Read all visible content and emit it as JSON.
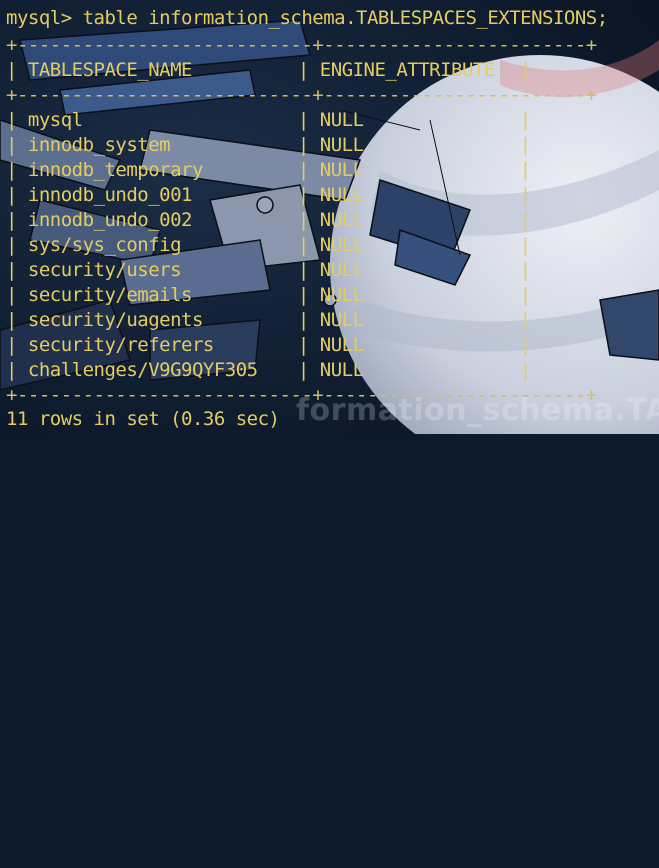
{
  "terminal": {
    "prompt": "mysql> ",
    "command": "table information_schema.TABLESPACES_EXTENSIONS;",
    "separator": "+---------------------------+------------------------+",
    "columns": [
      "TABLESPACE_NAME",
      "ENGINE_ATTRIBUTE"
    ],
    "rows": [
      [
        "mysql",
        "NULL"
      ],
      [
        "innodb_system",
        "NULL"
      ],
      [
        "innodb_temporary",
        "NULL"
      ],
      [
        "innodb_undo_001",
        "NULL"
      ],
      [
        "innodb_undo_002",
        "NULL"
      ],
      [
        "sys/sys_config",
        "NULL"
      ],
      [
        "security/users",
        "NULL"
      ],
      [
        "security/emails",
        "NULL"
      ],
      [
        "security/uagents",
        "NULL"
      ],
      [
        "security/referers",
        "NULL"
      ],
      [
        "challenges/V9G9QYF305",
        "NULL"
      ]
    ],
    "status": "11 rows in set (0.36 sec)"
  },
  "background": {
    "watermark_text": "formation_schema.TABL",
    "colors": {
      "space": "#0d1a2e",
      "planet": "#d8dce8",
      "terminal_text": "#e3cd62"
    }
  }
}
